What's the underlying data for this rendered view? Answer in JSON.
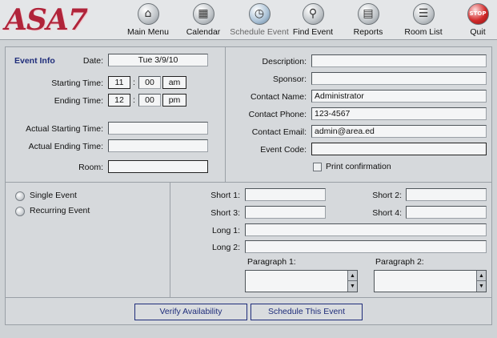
{
  "logo": "ASA7",
  "nav": [
    {
      "label": "Main Menu",
      "icon": "home-icon"
    },
    {
      "label": "Calendar",
      "icon": "calendar-icon"
    },
    {
      "label": "Schedule Event",
      "icon": "clock-icon"
    },
    {
      "label": "Find Event",
      "icon": "magnifier-icon"
    },
    {
      "label": "Reports",
      "icon": "printer-icon"
    },
    {
      "label": "Room List",
      "icon": "list-icon"
    },
    {
      "label": "Quit",
      "icon": "stop-sign-icon",
      "icon_text": "STOP"
    }
  ],
  "event_info": {
    "title": "Event Info",
    "date_label": "Date:",
    "date_value": "Tue 3/9/10",
    "start_label": "Starting Time:",
    "start_hour": "11",
    "start_min": "00",
    "start_ampm": "am",
    "end_label": "Ending Time:",
    "end_hour": "12",
    "end_min": "00",
    "end_ampm": "pm",
    "colon": ":",
    "actual_start_label": "Actual Starting Time:",
    "actual_start_value": "",
    "actual_end_label": "Actual Ending Time:",
    "actual_end_value": "",
    "room_label": "Room:",
    "room_value": ""
  },
  "contact": {
    "description_label": "Description:",
    "description_value": "",
    "sponsor_label": "Sponsor:",
    "sponsor_value": "",
    "name_label": "Contact Name:",
    "name_value": "Administrator",
    "phone_label": "Contact Phone:",
    "phone_value": "123-4567",
    "email_label": "Contact Email:",
    "email_value": "admin@area.ed",
    "code_label": "Event Code:",
    "code_value": "",
    "print_label": "Print confirmation"
  },
  "event_type": {
    "single_label": "Single Event",
    "recurring_label": "Recurring Event"
  },
  "extra": {
    "short1_label": "Short 1:",
    "short2_label": "Short 2:",
    "short3_label": "Short 3:",
    "short4_label": "Short 4:",
    "long1_label": "Long 1:",
    "long2_label": "Long 2:",
    "para1_label": "Paragraph 1:",
    "para2_label": "Paragraph 2:",
    "spin_up": "▲",
    "spin_down": "▼"
  },
  "buttons": {
    "verify": "Verify Availability",
    "schedule": "Schedule This Event"
  }
}
